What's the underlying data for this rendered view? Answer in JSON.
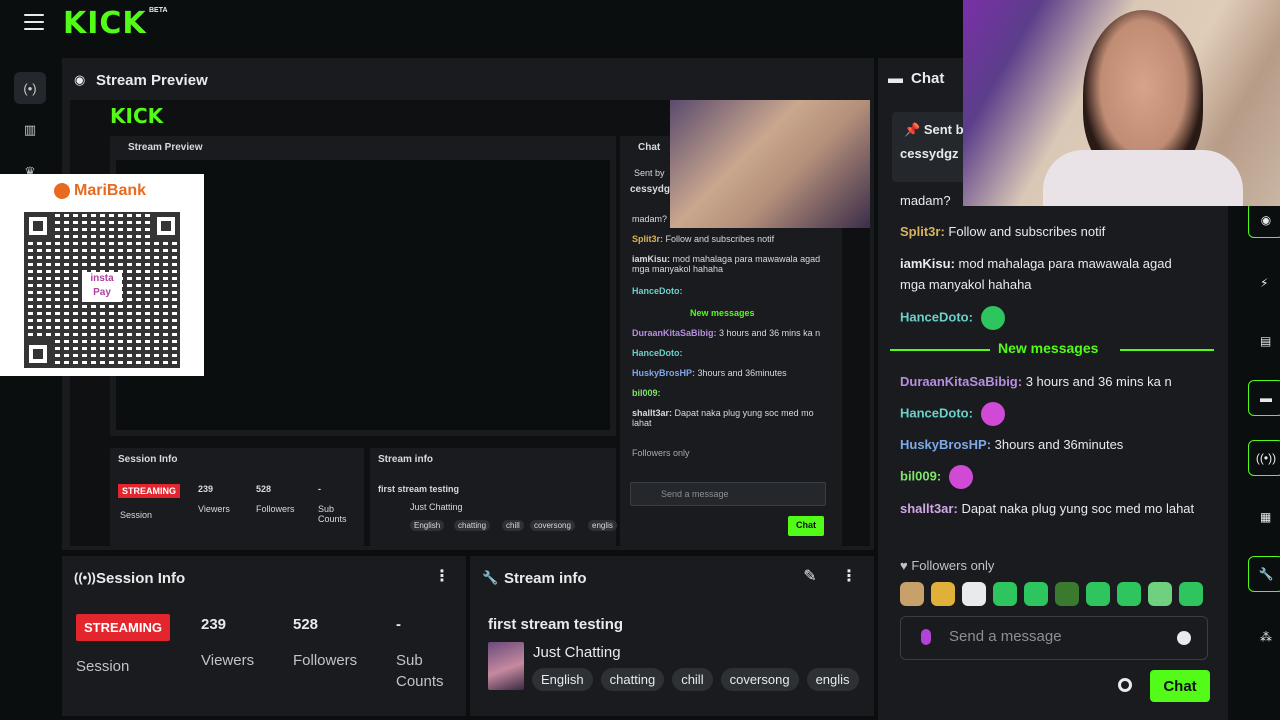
{
  "app": {
    "logo": "KICK",
    "beta": "BETA"
  },
  "preview": {
    "title": "Stream Preview"
  },
  "nested": {
    "preview_title": "Stream Preview",
    "chat_title": "Chat",
    "sent_by": "Sent by",
    "pinned_user": "cessydgz",
    "session_title": "Session Info",
    "stream_title": "Stream info",
    "streaming": "STREAMING",
    "viewers": "239",
    "followers": "528",
    "subs": "-",
    "viewers_lbl": "Viewers",
    "followers_lbl": "Followers",
    "subs_lbl": "Sub Counts",
    "session_lbl": "Session",
    "si_title": "first stream testing",
    "category": "Just Chatting",
    "tags": [
      "English",
      "chatting",
      "chill",
      "coversong",
      "englis"
    ],
    "msgs": [
      {
        "u": "madam?",
        "t": ""
      },
      {
        "u": "Split3r:",
        "t": "Follow and subscribes notif"
      },
      {
        "u": "iamKisu:",
        "t": "mod mahalaga para mawawala agad mga manyakol hahaha"
      },
      {
        "u": "HanceDoto:",
        "t": ""
      },
      {
        "u": "DuraanKitaSaBibig:",
        "t": "3 hours and 36 mins ka n"
      },
      {
        "u": "HanceDoto:",
        "t": ""
      },
      {
        "u": "HuskyBrosHP:",
        "t": "3hours and 36minutes"
      },
      {
        "u": "bil009:",
        "t": ""
      },
      {
        "u": "shallt3ar:",
        "t": "Dapat naka plug yung soc med mo lahat"
      }
    ],
    "new_messages": "New messages",
    "followers_only": "Followers only",
    "send": "Send a message",
    "chat_btn": "Chat"
  },
  "session": {
    "title": "Session Info",
    "badge": "STREAMING",
    "badge_label": "Session",
    "viewers_value": "239",
    "viewers_label": "Viewers",
    "followers_value": "528",
    "followers_label": "Followers",
    "subs_value": "-",
    "subs_label_1": "Sub",
    "subs_label_2": "Counts"
  },
  "stream_info": {
    "title": "Stream info",
    "stream_title": "first stream testing",
    "category": "Just Chatting",
    "tags": [
      "English",
      "chatting",
      "chill",
      "coversong",
      "englis"
    ]
  },
  "chat": {
    "title": "Chat",
    "pinned_label": "Sent by",
    "pinned_user": "cessydgz",
    "first_line": "madam?",
    "messages": [
      {
        "user": "Split3r:",
        "text": "Follow and subscribes notif",
        "color": "#d9b45b"
      },
      {
        "user": "iamKisu:",
        "text": "mod mahalaga para mawawala agad mga manyakol hahaha",
        "color": "#e8eaeb"
      },
      {
        "user": "HanceDoto:",
        "text": "",
        "color": "#6bd0c9"
      },
      {
        "user": "DuraanKitaSaBibig:",
        "text": "3 hours and 36 mins ka n",
        "color": "#b78ee0"
      },
      {
        "user": "HanceDoto:",
        "text": "",
        "color": "#6bd0c9"
      },
      {
        "user": "HuskyBrosHP:",
        "text": "3hours and 36minutes",
        "color": "#7fa8e8"
      },
      {
        "user": "bil009:",
        "text": "",
        "color": "#7fe36a"
      },
      {
        "user": "shallt3ar:",
        "text": "Dapat naka plug yung soc med mo lahat",
        "color": "#d3a6e8"
      }
    ],
    "new_messages": "New messages",
    "followers_only": "Followers only",
    "send_placeholder": "Send a message",
    "chat_button": "Chat"
  },
  "qr": {
    "brand": "MariBank",
    "center": "insta Pay"
  },
  "colors": {
    "accent": "#53fc18",
    "streaming": "#e3262d",
    "panel": "#191b1f"
  }
}
